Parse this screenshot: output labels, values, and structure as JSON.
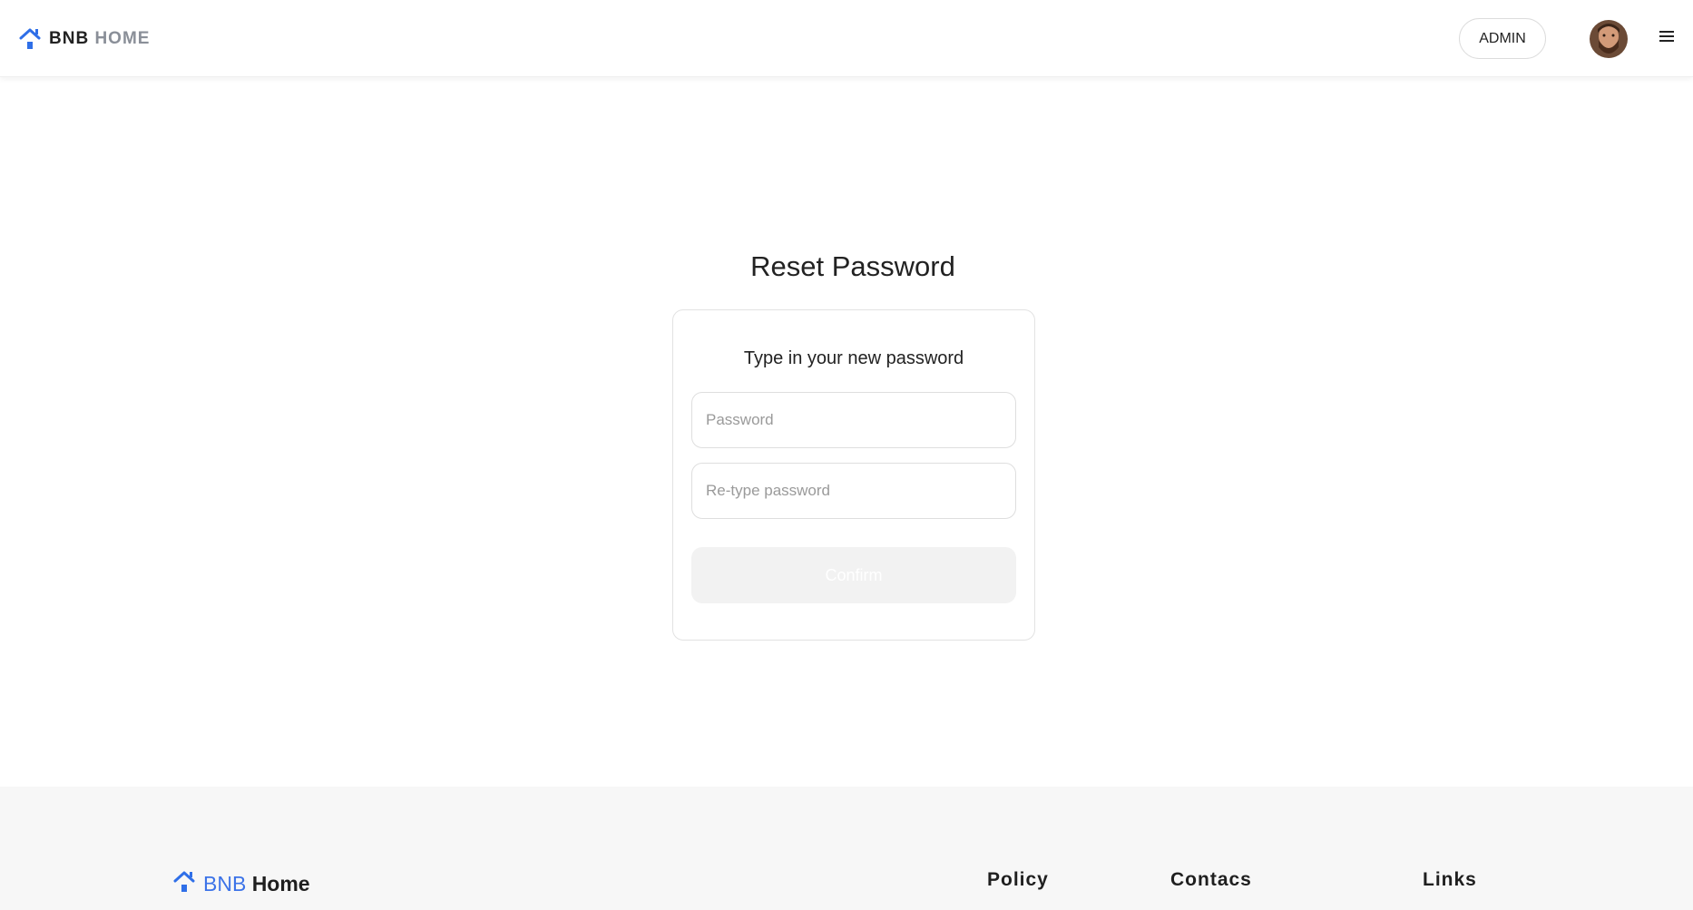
{
  "header": {
    "brand_part1": "BNB",
    "brand_part2": "HOME",
    "admin_label": "ADMIN",
    "avatar_icon": "user-avatar",
    "menu_icon": "hamburger-menu-icon"
  },
  "main": {
    "title": "Reset Password",
    "card": {
      "subtitle": "Type in your new password",
      "password_placeholder": "Password",
      "retype_placeholder": "Re-type password",
      "password_value": "",
      "retype_value": "",
      "confirm_label": "Confirm"
    }
  },
  "footer": {
    "brand_part1": "BNB",
    "brand_part2": "Home",
    "headings": [
      "Policy",
      "Contacs",
      "Links"
    ]
  },
  "colors": {
    "accent": "#3c73e8",
    "logo_blue": "#2f6fe8",
    "disabled_button": "#f2f2f2",
    "footer_bg": "#f7f7f7"
  }
}
